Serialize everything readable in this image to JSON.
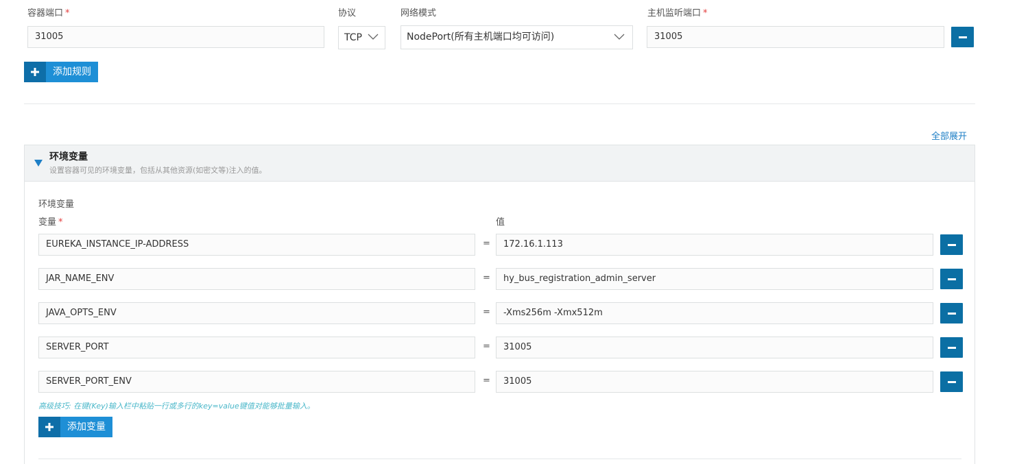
{
  "ports": {
    "container_port_label": "容器端口",
    "protocol_label": "协议",
    "network_mode_label": "网络模式",
    "host_port_label": "主机监听端口",
    "required_mark": "*",
    "container_port_value": "31005",
    "protocol_value": "TCP",
    "network_mode_value": "NodePort(所有主机端口均可访问)",
    "host_port_value": "31005",
    "add_rule_label": "添加规则"
  },
  "expand_all_label": "全部展开",
  "env_panel": {
    "title": "环境变量",
    "subtitle": "设置容器可见的环境变量，包括从其他资源(如密文等)注入的值。",
    "section_label": "环境变量",
    "key_label": "变量",
    "value_label": "值",
    "equals": "=",
    "rows": [
      {
        "key": "EUREKA_INSTANCE_IP-ADDRESS",
        "value": "172.16.1.113"
      },
      {
        "key": "JAR_NAME_ENV",
        "value": "hy_bus_registration_admin_server"
      },
      {
        "key": "JAVA_OPTS_ENV",
        "value": "-Xms256m -Xmx512m"
      },
      {
        "key": "SERVER_PORT",
        "value": "31005"
      },
      {
        "key": "SERVER_PORT_ENV",
        "value": "31005"
      }
    ],
    "tip": "高级技巧: 在键(Key)输入栏中粘贴一行或多行的key=value键值对能够批量输入。",
    "add_var_label": "添加变量"
  },
  "colors": {
    "primary_dark": "#0b6fa4",
    "primary": "#1e8fd6",
    "required": "#e23c3c",
    "link": "#1e7fc6",
    "tip": "#4ab7c9"
  }
}
